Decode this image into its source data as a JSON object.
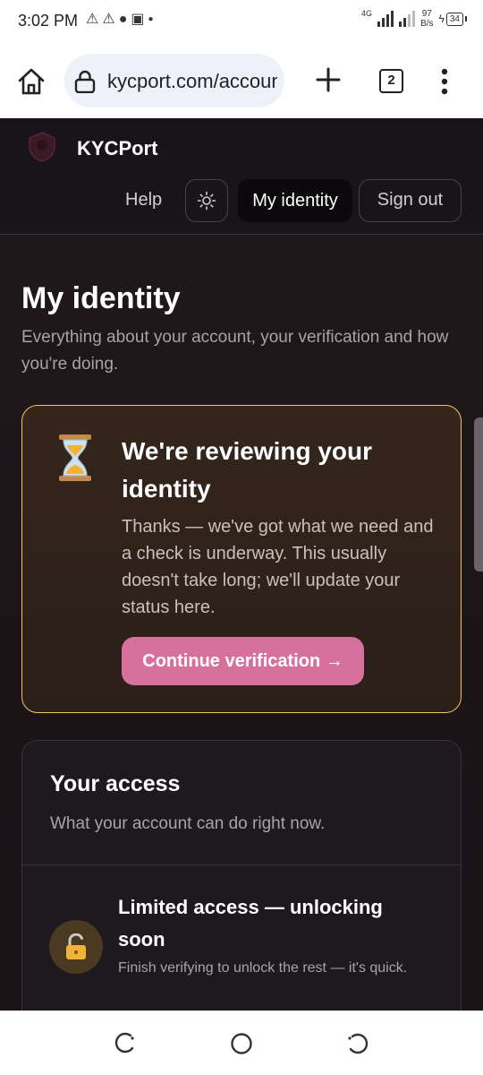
{
  "status_bar": {
    "time": "3:02 PM",
    "network_label": "4G",
    "speed_value": "97",
    "speed_unit": "B/s",
    "battery": "34"
  },
  "browser": {
    "url": "kycport.com/account",
    "tab_count": "2"
  },
  "site": {
    "brand": "KYCPort",
    "nav": {
      "help": "Help",
      "my_identity": "My identity",
      "sign_out": "Sign out"
    }
  },
  "page": {
    "title": "My identity",
    "subtitle": "Everything about your account, your verification and how you're doing."
  },
  "review_card": {
    "title": "We're reviewing your identity",
    "body": "Thanks — we've got what we need and a check is underway. This usually doesn't take long; we'll update your status here.",
    "button": "Continue verification →"
  },
  "access_card": {
    "title": "Your access",
    "subtitle": "What your account can do right now.",
    "item_title": "Limited access — unlocking soon",
    "item_desc": "Finish verifying to unlock the rest — it's quick."
  },
  "colors": {
    "accent_pink": "#d8709e",
    "warning_border": "#f2c75a",
    "page_bg": "#1b1619"
  },
  "icons": [
    "home-icon",
    "lock-icon",
    "plus-icon",
    "more-vert-icon",
    "sun-icon",
    "hourglass-icon",
    "padlock-open-icon",
    "back-icon",
    "home-circle-icon",
    "recents-icon"
  ]
}
